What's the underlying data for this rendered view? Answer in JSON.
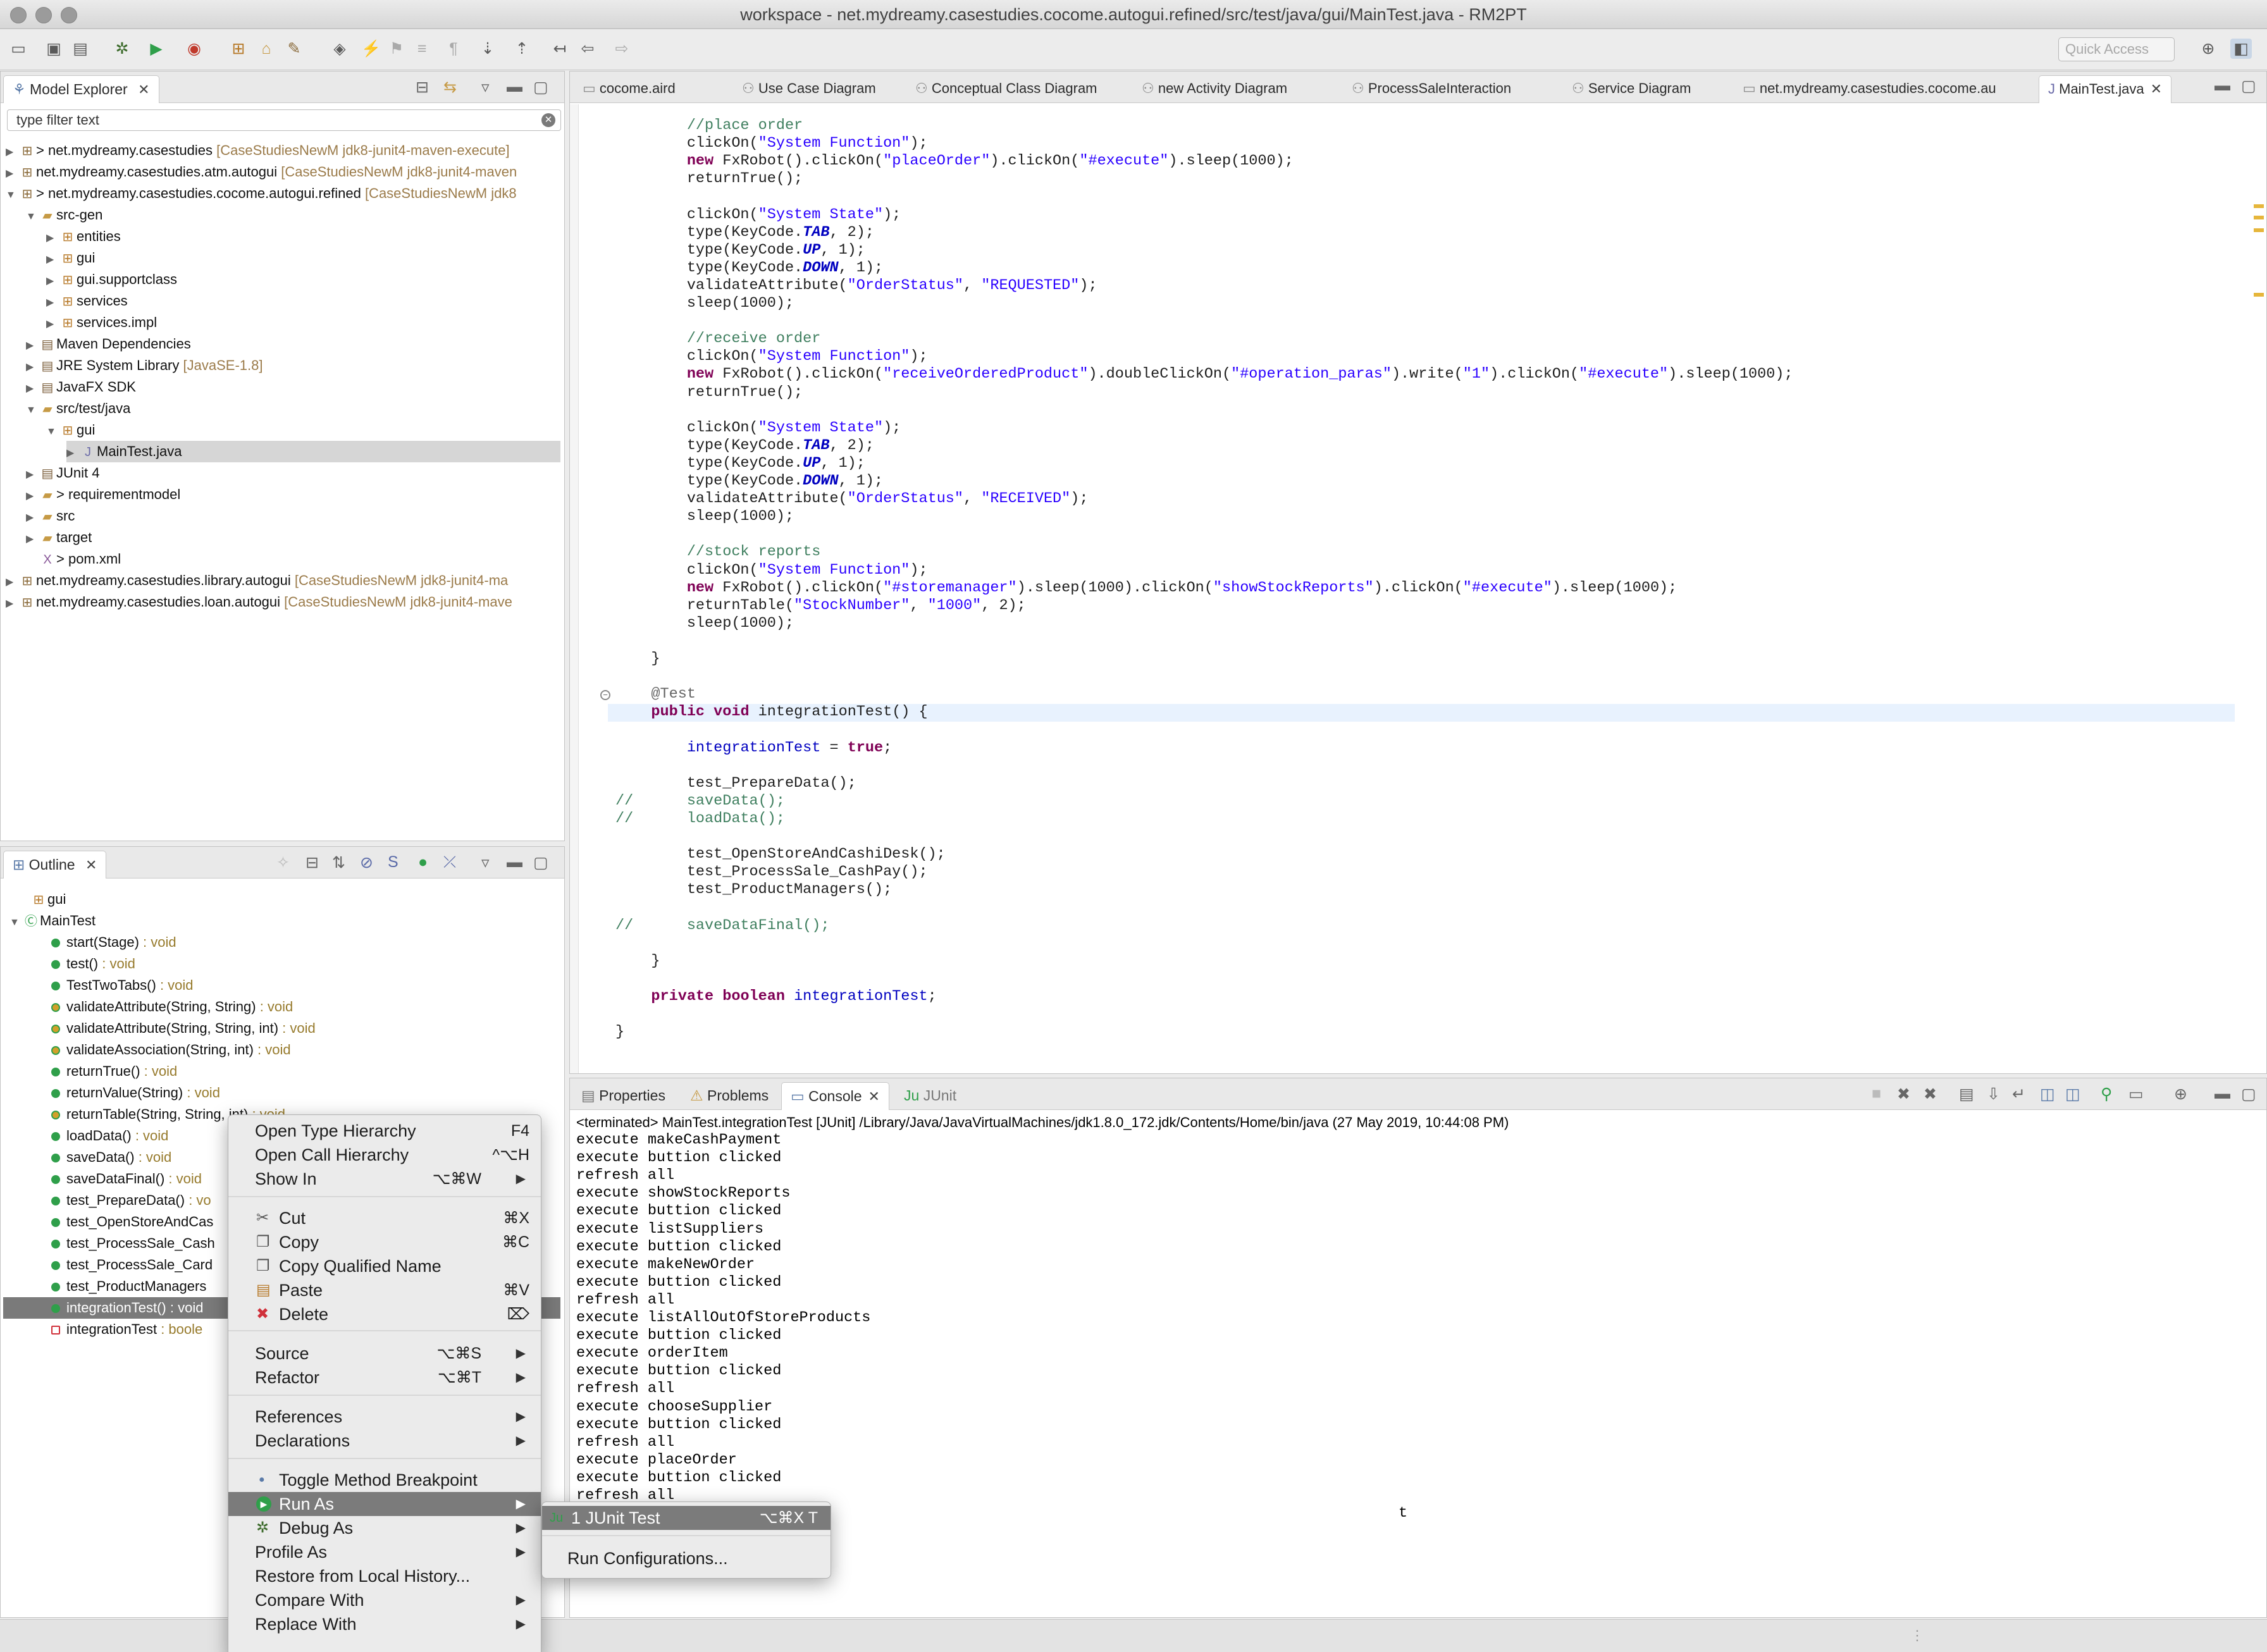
{
  "window": {
    "title": "workspace - net.mydreamy.casestudies.cocome.autogui.refined/src/test/java/gui/MainTest.java - RM2PT"
  },
  "toolbar": {
    "quick_access_placeholder": "Quick Access"
  },
  "model_explorer": {
    "tab_label": "Model Explorer",
    "filter_placeholder": "type filter text",
    "items": [
      {
        "label": "> net.mydreamy.casestudies",
        "decoration": "[CaseStudiesNewM jdk8-junit4-maven-execute]"
      },
      {
        "label": "net.mydreamy.casestudies.atm.autogui",
        "decoration": "[CaseStudiesNewM jdk8-junit4-maven"
      },
      {
        "label": "> net.mydreamy.casestudies.cocome.autogui.refined",
        "decoration": "[CaseStudiesNewM jdk8"
      },
      {
        "label": "src-gen",
        "decoration": ""
      },
      {
        "label": "entities",
        "decoration": ""
      },
      {
        "label": "gui",
        "decoration": ""
      },
      {
        "label": "gui.supportclass",
        "decoration": ""
      },
      {
        "label": "services",
        "decoration": ""
      },
      {
        "label": "services.impl",
        "decoration": ""
      },
      {
        "label": "Maven Dependencies",
        "decoration": ""
      },
      {
        "label": "JRE System Library",
        "decoration": "[JavaSE-1.8]"
      },
      {
        "label": "JavaFX SDK",
        "decoration": ""
      },
      {
        "label": "src/test/java",
        "decoration": ""
      },
      {
        "label": "gui",
        "decoration": ""
      },
      {
        "label": "MainTest.java",
        "decoration": ""
      },
      {
        "label": "JUnit 4",
        "decoration": ""
      },
      {
        "label": "> requirementmodel",
        "decoration": ""
      },
      {
        "label": "src",
        "decoration": ""
      },
      {
        "label": "target",
        "decoration": ""
      },
      {
        "label": "> pom.xml",
        "decoration": ""
      },
      {
        "label": "net.mydreamy.casestudies.library.autogui",
        "decoration": "[CaseStudiesNewM jdk8-junit4-ma"
      },
      {
        "label": "net.mydreamy.casestudies.loan.autogui",
        "decoration": "[CaseStudiesNewM jdk8-junit4-mave"
      }
    ]
  },
  "outline": {
    "tab_label": "Outline",
    "items": [
      {
        "label": "gui",
        "type": ""
      },
      {
        "label": "MainTest",
        "type": ""
      },
      {
        "label": "start(Stage)",
        "type": " : void"
      },
      {
        "label": "test()",
        "type": " : void"
      },
      {
        "label": "TestTwoTabs()",
        "type": " : void"
      },
      {
        "label": "validateAttribute(String, String)",
        "type": " : void"
      },
      {
        "label": "validateAttribute(String, String, int)",
        "type": " : void"
      },
      {
        "label": "validateAssociation(String, int)",
        "type": " : void"
      },
      {
        "label": "returnTrue()",
        "type": " : void"
      },
      {
        "label": "returnValue(String)",
        "type": " : void"
      },
      {
        "label": "returnTable(String, String, int)",
        "type": " : void"
      },
      {
        "label": "loadData()",
        "type": " : void"
      },
      {
        "label": "saveData()",
        "type": " : void"
      },
      {
        "label": "saveDataFinal()",
        "type": " : void"
      },
      {
        "label": "test_PrepareData()",
        "type": " : vo"
      },
      {
        "label": "test_OpenStoreAndCas",
        "type": ""
      },
      {
        "label": "test_ProcessSale_Cash",
        "type": ""
      },
      {
        "label": "test_ProcessSale_Card",
        "type": ""
      },
      {
        "label": "test_ProductManagers",
        "type": ""
      },
      {
        "label": "integrationTest()",
        "type": " : void"
      },
      {
        "label": "integrationTest",
        "type": " : boole"
      }
    ]
  },
  "editor": {
    "tabs": [
      "cocome.aird",
      "Use Case Diagram",
      "Conceptual Class Diagram",
      "new Activity Diagram",
      "ProcessSaleInteraction",
      "Service Diagram",
      "net.mydreamy.casestudies.cocome.au",
      "MainTest.java"
    ],
    "lines": [
      "        //place order",
      "        clickOn(\"System Function\");",
      "        new FxRobot().clickOn(\"placeOrder\").clickOn(\"#execute\").sleep(1000);",
      "        returnTrue();",
      "",
      "        clickOn(\"System State\");",
      "        type(KeyCode.TAB, 2);",
      "        type(KeyCode.UP, 1);",
      "        type(KeyCode.DOWN, 1);",
      "        validateAttribute(\"OrderStatus\", \"REQUESTED\");",
      "        sleep(1000);",
      "",
      "        //receive order",
      "        clickOn(\"System Function\");",
      "        new FxRobot().clickOn(\"receiveOrderedProduct\").doubleClickOn(\"#operation_paras\").write(\"1\").clickOn(\"#execute\").sleep(1000);",
      "        returnTrue();",
      "",
      "        clickOn(\"System State\");",
      "        type(KeyCode.TAB, 2);",
      "        type(KeyCode.UP, 1);",
      "        type(KeyCode.DOWN, 1);",
      "        validateAttribute(\"OrderStatus\", \"RECEIVED\");",
      "        sleep(1000);",
      "",
      "        //stock reports",
      "        clickOn(\"System Function\");",
      "        new FxRobot().clickOn(\"#storemanager\").sleep(1000).clickOn(\"showStockReports\").clickOn(\"#execute\").sleep(1000);",
      "        returnTable(\"StockNumber\", \"1000\", 2);",
      "        sleep(1000);",
      "",
      "    }",
      "",
      "    @Test",
      "    public void integrationTest() {",
      "",
      "        integrationTest = true;",
      "",
      "        test_PrepareData();",
      "//      saveData();",
      "//      loadData();",
      "",
      "        test_OpenStoreAndCashiDesk();",
      "        test_ProcessSale_CashPay();",
      "        test_ProductManagers();",
      "",
      "//      saveDataFinal();",
      "",
      "    }",
      "",
      "    private boolean integrationTest;",
      "",
      "}"
    ]
  },
  "bottom_panel": {
    "tabs": [
      "Properties",
      "Problems",
      "Console",
      "JUnit"
    ],
    "console_header": "<terminated> MainTest.integrationTest [JUnit] /Library/Java/JavaVirtualMachines/jdk1.8.0_172.jdk/Contents/Home/bin/java (27 May 2019, 10:44:08 PM)",
    "console_lines": [
      "execute makeCashPayment",
      "execute buttion clicked",
      "refresh all",
      "execute showStockReports",
      "execute buttion clicked",
      "execute listSuppliers",
      "execute buttion clicked",
      "execute makeNewOrder",
      "execute buttion clicked",
      "refresh all",
      "execute listAllOutOfStoreProducts",
      "execute buttion clicked",
      "execute orderItem",
      "execute buttion clicked",
      "refresh all",
      "execute chooseSupplier",
      "execute buttion clicked",
      "refresh all",
      "execute placeOrder",
      "execute buttion clicked",
      "refresh all",
      "t",
      "",
      "",
      "execute buttion clicked"
    ]
  },
  "context_menu": {
    "items": [
      {
        "label": "Open Type Hierarchy",
        "shortcut": "F4",
        "submenu": false
      },
      {
        "label": "Open Call Hierarchy",
        "shortcut": "^⌥H",
        "submenu": false
      },
      {
        "label": "Show In",
        "shortcut": "⌥⌘W",
        "submenu": true
      },
      {
        "label": "Cut",
        "shortcut": "⌘X",
        "submenu": false
      },
      {
        "label": "Copy",
        "shortcut": "⌘C",
        "submenu": false
      },
      {
        "label": "Copy Qualified Name",
        "shortcut": "",
        "submenu": false
      },
      {
        "label": "Paste",
        "shortcut": "⌘V",
        "submenu": false
      },
      {
        "label": "Delete",
        "shortcut": "⌦",
        "submenu": false
      },
      {
        "label": "Source",
        "shortcut": "⌥⌘S",
        "submenu": true
      },
      {
        "label": "Refactor",
        "shortcut": "⌥⌘T",
        "submenu": true
      },
      {
        "label": "References",
        "shortcut": "",
        "submenu": true
      },
      {
        "label": "Declarations",
        "shortcut": "",
        "submenu": true
      },
      {
        "label": "Toggle Method Breakpoint",
        "shortcut": "",
        "submenu": false
      },
      {
        "label": "Run As",
        "shortcut": "",
        "submenu": true
      },
      {
        "label": "Debug As",
        "shortcut": "",
        "submenu": true
      },
      {
        "label": "Profile As",
        "shortcut": "",
        "submenu": true
      },
      {
        "label": "Restore from Local History...",
        "shortcut": "",
        "submenu": false
      },
      {
        "label": "Compare With",
        "shortcut": "",
        "submenu": true
      },
      {
        "label": "Replace With",
        "shortcut": "",
        "submenu": true
      }
    ],
    "submenu": {
      "junit_label": "1 JUnit Test",
      "junit_shortcut": "⌥⌘X T",
      "configs_label": "Run Configurations..."
    }
  }
}
